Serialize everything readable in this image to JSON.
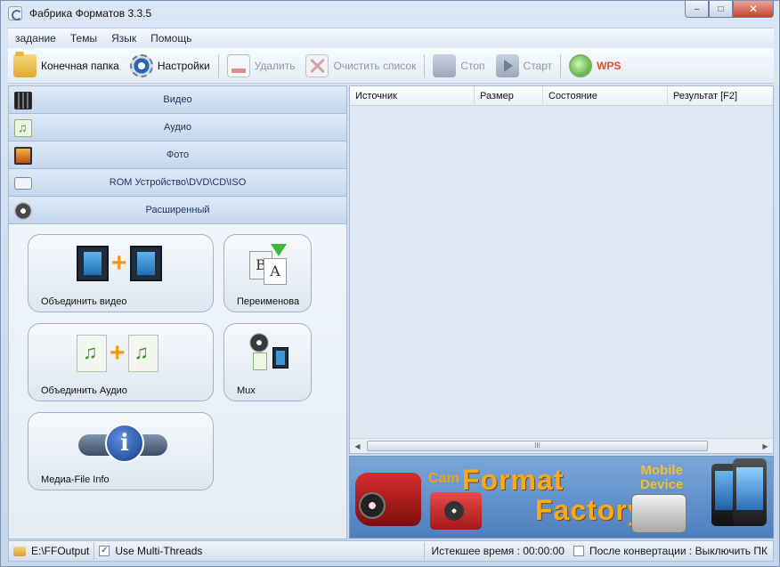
{
  "window": {
    "title": "Фабрика Форматов 3.3.5",
    "buttons": {
      "minimize": "–",
      "maximize": "□",
      "close": "✕"
    }
  },
  "menu": {
    "items": [
      "задание",
      "Темы",
      "Язык",
      "Помощь"
    ]
  },
  "toolbar": {
    "output_folder": "Конечная папка",
    "settings": "Настройки",
    "delete": "Удалить",
    "clear_list": "Очистить список",
    "stop": "Стоп",
    "start": "Старт",
    "wps": "WPS"
  },
  "categories": [
    {
      "label": "Видео",
      "icon": "video-icon"
    },
    {
      "label": "Аудио",
      "icon": "audio-icon"
    },
    {
      "label": "Фото",
      "icon": "photo-icon"
    },
    {
      "label": "ROM Устройство\\DVD\\CD\\ISO",
      "icon": "rom-icon"
    },
    {
      "label": "Расширенный",
      "icon": "film-reel-icon"
    }
  ],
  "tools": {
    "join_video": "Объединить видео",
    "rename": "Переименова",
    "join_audio": "Объединить Аудио",
    "mux": "Mux",
    "media_info": "Медиа-File Info"
  },
  "file_list": {
    "columns": [
      "Источник",
      "Размер",
      "Состояние",
      "Результат [F2]"
    ],
    "rows": [],
    "scroll_thumb": "III"
  },
  "banner": {
    "cam_text": "Cam",
    "brand_line1": "Format",
    "brand_line2": "Factory",
    "mobile_line1": "Mobile",
    "mobile_line2": "Device"
  },
  "statusbar": {
    "output_path": "E:\\FFOutput",
    "multithreads_label": "Use Multi-Threads",
    "multithreads_checked": true,
    "elapsed": "Истекшее время : 00:00:00",
    "after_convert": "После конвертации : Выключить ПК",
    "after_convert_checked": false
  },
  "colors": {
    "accent": "#1c3660",
    "brand_orange": "#f9a91a",
    "wps_red": "#e0502a"
  }
}
